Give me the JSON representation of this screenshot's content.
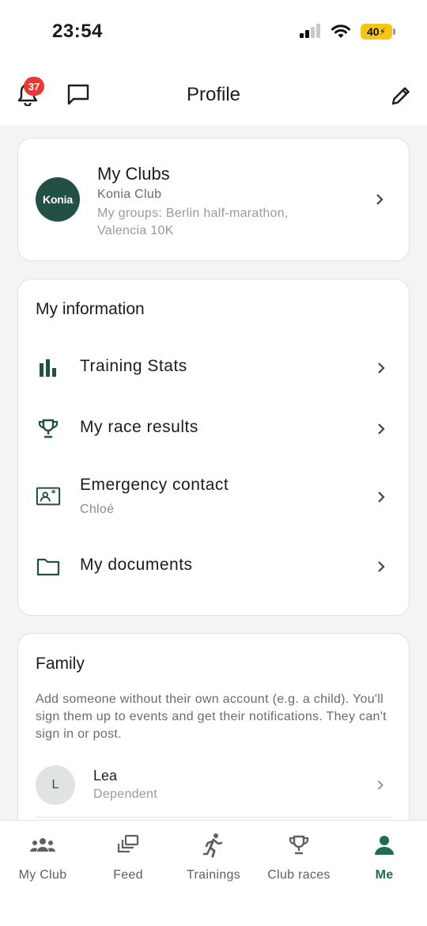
{
  "status_bar": {
    "time": "23:54",
    "battery": "40"
  },
  "header": {
    "title": "Profile",
    "notifications_count": "37"
  },
  "clubs": {
    "title": "My Clubs",
    "logo_text": "Konia",
    "club_name": "Konia Club",
    "groups": "My groups: Berlin half-marathon, Valencia 10K"
  },
  "my_information": {
    "title": "My information",
    "items": [
      {
        "label": "Training Stats",
        "icon": "bar-chart-icon"
      },
      {
        "label": "My race results",
        "icon": "trophy-icon"
      },
      {
        "label": "Emergency contact",
        "sub": "Chloé",
        "icon": "contact-card-icon"
      },
      {
        "label": "My documents",
        "icon": "folder-icon"
      }
    ]
  },
  "family": {
    "title": "Family",
    "description": "Add someone without their own account (e.g. a child). You'll sign them up to events and get their notifications. They can't sign in or post.",
    "members": [
      {
        "initial": "L",
        "name": "Lea",
        "role": "Dependent"
      }
    ]
  },
  "tabs": [
    {
      "label": "My Club",
      "icon": "group-icon",
      "active": false
    },
    {
      "label": "Feed",
      "icon": "feed-icon",
      "active": false
    },
    {
      "label": "Trainings",
      "icon": "runner-icon",
      "active": false
    },
    {
      "label": "Club races",
      "icon": "trophy-icon",
      "active": false
    },
    {
      "label": "Me",
      "icon": "person-icon",
      "active": true
    }
  ],
  "colors": {
    "accent": "#1d6b5b",
    "logo_bg": "#235046",
    "badge": "#e53935",
    "battery": "#f5c518"
  }
}
